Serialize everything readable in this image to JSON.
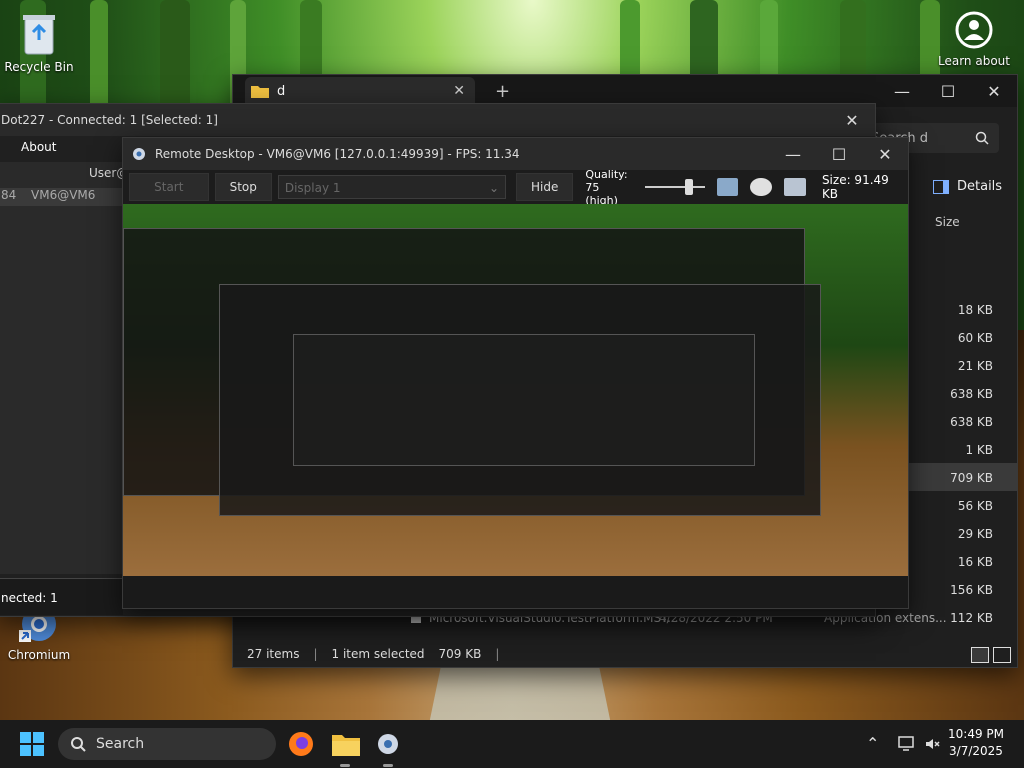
{
  "desktop": {
    "icons": [
      {
        "label": "Recycle Bin",
        "icon": "recycle-bin-icon"
      },
      {
        "label": "Learn about",
        "icon": "learn-about-icon"
      },
      {
        "label": "Chromium",
        "icon": "chromium-icon"
      }
    ]
  },
  "explorer": {
    "tab_title": "d",
    "search_placeholder": "Search d",
    "details_label": "Details",
    "column_size": "Size",
    "sizes": [
      "18 KB",
      "60 KB",
      "21 KB",
      "638 KB",
      "638 KB",
      "1 KB",
      "709 KB",
      "56 KB",
      "29 KB",
      "16 KB",
      "156 KB",
      "112 KB"
    ],
    "last_row": {
      "name": "Microsoft.VisualStudio.TestPlatform.MST...",
      "date": "4/28/2022 2:50 PM",
      "type": "Application extens..."
    },
    "status": {
      "items": "27 items",
      "selected": "1 item selected",
      "size": "709 KB"
    }
  },
  "server_window": {
    "title": "Dot227 - Connected: 1 [Selected: 1]",
    "menu_about": "About",
    "col_user": "User@",
    "row_cell": "VM6@VM6",
    "row_left": "84",
    "status": "nected: 1"
  },
  "remote_desktop": {
    "title": "Remote Desktop - VM6@VM6 [127.0.0.1:49939] - FPS: 11.34",
    "start": "Start",
    "stop": "Stop",
    "display": "Display 1",
    "hide": "Hide",
    "quality_label": "Quality:",
    "quality_value": "75 (high)",
    "size": "Size: 91.49 KB"
  },
  "taskbar": {
    "search_label": "Search",
    "time": "10:49 PM",
    "date": "3/7/2025"
  }
}
